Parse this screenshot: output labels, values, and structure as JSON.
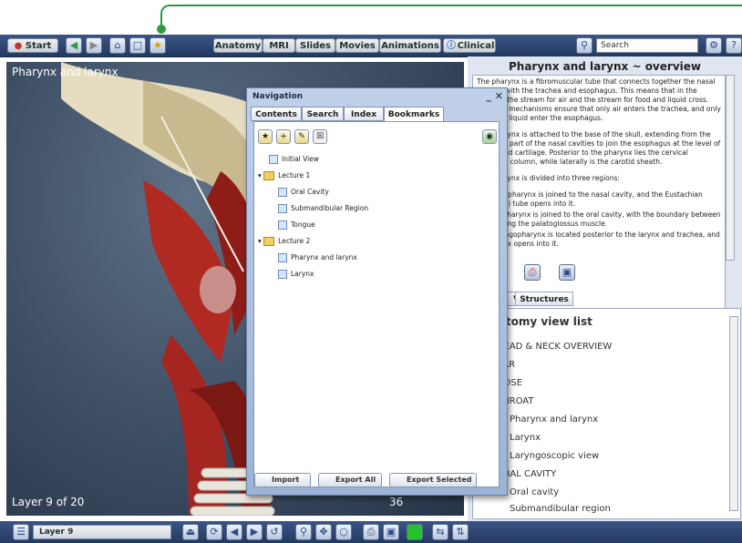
{
  "toolbar": {
    "start": "Start",
    "tabs": [
      "Anatomy",
      "MRI",
      "Slides",
      "Movies",
      "Animations",
      "Clinical"
    ],
    "search_placeholder": "Search"
  },
  "viewport": {
    "title": "Pharynx and larynx",
    "layer": "Layer 9 of 20",
    "frame": "Frame 33 of 36"
  },
  "bottom": {
    "layer_select": "Layer 9"
  },
  "overview": {
    "title": "Pharynx and larynx ~ overview",
    "paragraphs": [
      "The pharynx is a fibromuscular tube that connects together the nasal cavities with the trachea and esophagus. This means that in the pharynx the stream for air and the stream for food and liquid cross. Complex mechanisms ensure that only air enters the trachea, and only food and liquid enter the esophagus.",
      "The pharynx is attached to the base of the skull, extending from the posterior part of the nasal cavities to join the esophagus at the level of the cricoid cartilage. Posterior to the pharynx lies the cervical vertebral column, while laterally is the carotid sheath.",
      "The pharynx is divided into three regions:",
      "The nasopharynx is joined to the nasal cavity, and the Eustachian (auditory) tube opens into it.",
      "The oropharynx is joined to the oral cavity, with the boundary between them being the palatoglossus muscle.",
      "The laryngopharynx is located posterior to the larynx and trachea, and the larynx opens into it."
    ]
  },
  "lower_tabs": [
    "Views",
    "Structures"
  ],
  "list": {
    "title": "Anatomy view list",
    "items": [
      "HEAD & NECK OVERVIEW",
      "EAR",
      "NOSE",
      "THROAT",
      "Pharynx and larynx",
      "Larynx",
      "Laryngoscopic view",
      "ORAL CAVITY",
      "Oral cavity",
      "Submandibular region",
      "Tongue"
    ]
  },
  "nav": {
    "title": "Navigation",
    "tabs": [
      "Contents",
      "Search",
      "Index",
      "Bookmarks"
    ],
    "tree": {
      "initial": "Initial View",
      "lecture1": "Lecture 1",
      "l1_items": [
        "Oral Cavity",
        "Submandibular Region",
        "Tongue"
      ],
      "lecture2": "Lecture 2",
      "l2_items": [
        "Pharynx and larynx",
        "Larynx"
      ]
    },
    "buttons": [
      "Import",
      "Export All",
      "Export Selected"
    ]
  },
  "colors": {
    "accent_green": "#2e9b3a",
    "toolbar_blue": "#2d4672"
  }
}
